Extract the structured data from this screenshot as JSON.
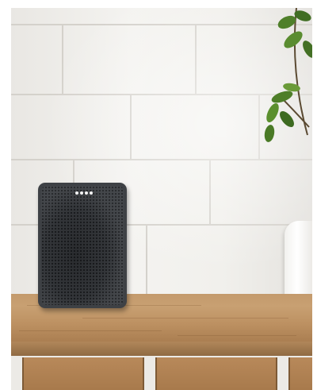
{
  "image": {
    "description": "",
    "colors": {
      "wall": "#efede9",
      "speaker": "#3e4145",
      "wood": "#c49a6c",
      "leaf": "#4f7f2a",
      "led": "#f4f4f4"
    },
    "icons": [
      "smart-speaker-icon",
      "houseplant-icon"
    ]
  }
}
